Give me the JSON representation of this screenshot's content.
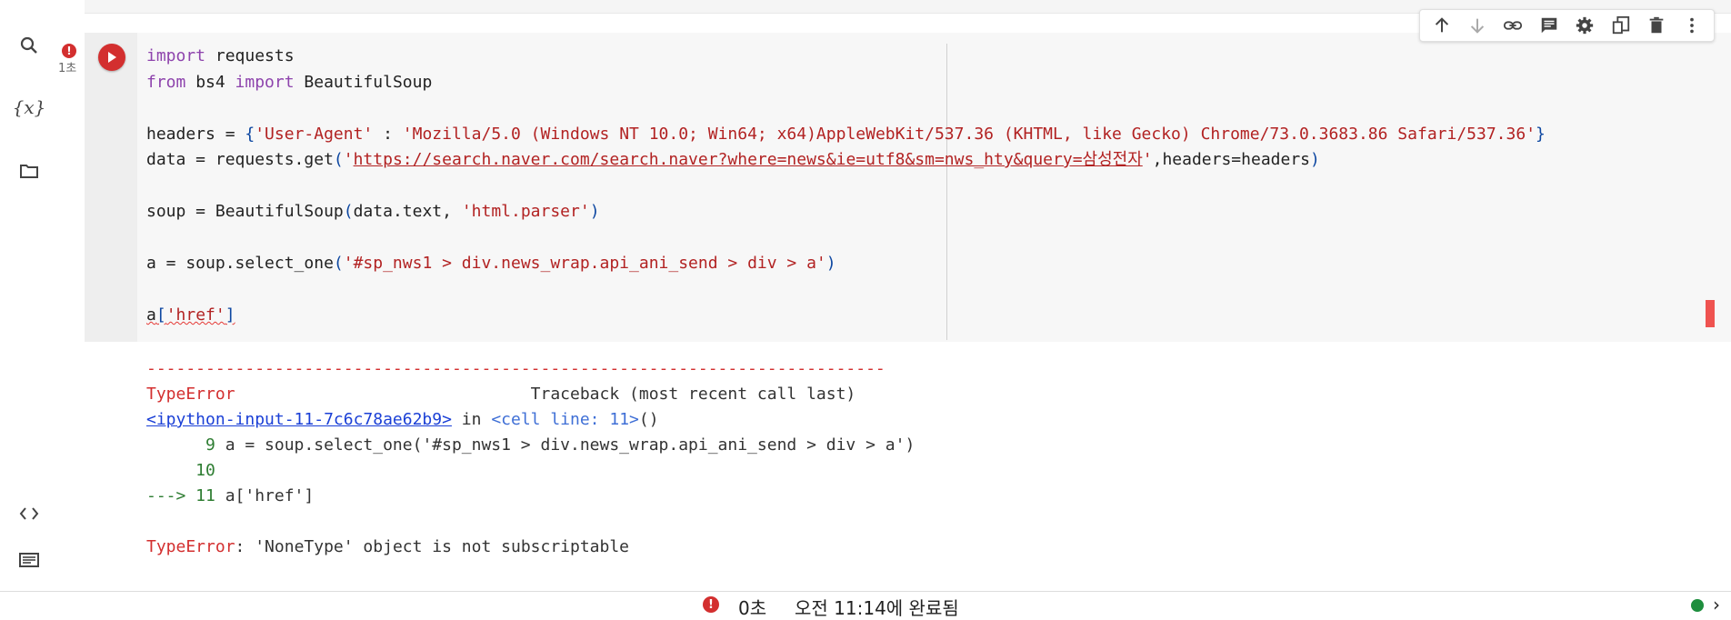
{
  "cell": {
    "exec_time": "1초",
    "error_badge": "!",
    "code": {
      "l1_kw": "import",
      "l1_rest": " requests",
      "l2_kw1": "from",
      "l2_mid": " bs4 ",
      "l2_kw2": "import",
      "l2_rest": " BeautifulSoup",
      "l4_a": "headers = ",
      "l4_b": "{",
      "l4_c": "'User-Agent'",
      "l4_d": " : ",
      "l4_e": "'Mozilla/5.0 (Windows NT 10.0; Win64; x64)AppleWebKit/537.36 (KHTML, like Gecko) Chrome/73.0.3683.86 Safari/537.36'",
      "l4_f": "}",
      "l5_a": "data = requests.get",
      "l5_b": "(",
      "l5_c": "'",
      "l5_url": "https://search.naver.com/search.naver?where=news&ie=utf8&sm=nws_hty&query=삼성전자",
      "l5_d": "'",
      "l5_e": ",headers=headers",
      "l5_f": ")",
      "l7_a": "soup = BeautifulSoup",
      "l7_b": "(",
      "l7_c": "data.text, ",
      "l7_d": "'html.parser'",
      "l7_e": ")",
      "l9_a": "a = soup.select_one",
      "l9_b": "(",
      "l9_c": "'#sp_nws1 > div.news_wrap.api_ani_send > div > a'",
      "l9_d": ")",
      "l11_a": "a",
      "l11_b": "[",
      "l11_c": "'href'",
      "l11_d": "]"
    }
  },
  "output": {
    "dashes": "---------------------------------------------------------------------------",
    "err_type": "TypeError",
    "traceback_label": "                              Traceback (most recent call last)",
    "input_link": "<ipython-input-11-7c6c78ae62b9>",
    "in_word": " in ",
    "cell_line": "<cell line: 11>",
    "parens": "()",
    "tb1_num": "      9 ",
    "tb1_code": "a = soup.select_one('#sp_nws1 > div.news_wrap.api_ani_send > div > a')",
    "tb2_num": "     10",
    "tb3_arrow": "---> 11 ",
    "tb3_code": "a['href']",
    "final_type": "TypeError",
    "final_msg": ": 'NoneType' object is not subscriptable"
  },
  "status": {
    "error_badge": "!",
    "time": "0초",
    "text": "오전 11:14에 완료됨",
    "chevron": "›"
  },
  "icons": {
    "sidebar": [
      "search-icon",
      "variables-icon",
      "folder-icon",
      "code-icon",
      "terminal-icon"
    ],
    "toolbar": [
      "move-up-icon",
      "move-down-icon",
      "link-icon",
      "comment-icon",
      "settings-icon",
      "mirror-icon",
      "delete-icon",
      "more-icon"
    ]
  },
  "colors": {
    "accent_red": "#d32f2f",
    "status_green": "#1e8e3e"
  }
}
